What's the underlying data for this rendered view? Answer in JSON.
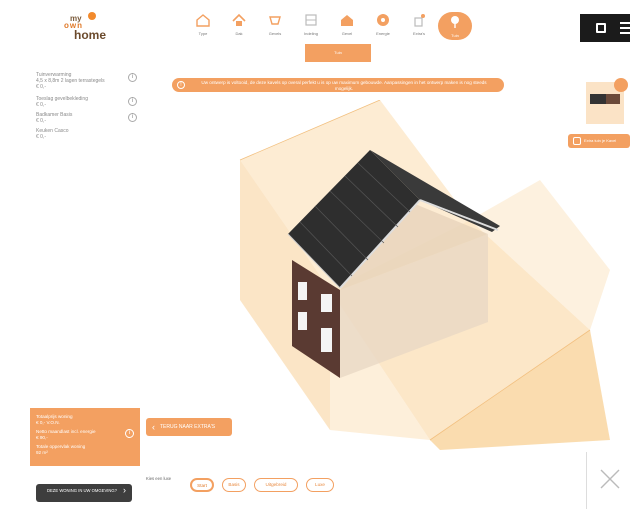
{
  "logo": {
    "line1": "my",
    "line2": "own",
    "line3": "home"
  },
  "nav": {
    "items": [
      {
        "label": "Type",
        "icon": "house-outline-icon"
      },
      {
        "label": "Dak",
        "icon": "roof-icon"
      },
      {
        "label": "Gevels",
        "icon": "facade-icon"
      },
      {
        "label": "Indeling",
        "icon": "floorplan-icon"
      },
      {
        "label": "Gevel",
        "icon": "house-filled-icon"
      },
      {
        "label": "Energie",
        "icon": "energy-icon"
      },
      {
        "label": "Extra's",
        "icon": "extras-icon"
      },
      {
        "label": "Tuin",
        "icon": "tree-icon"
      }
    ],
    "active_subtab": "Tuin"
  },
  "options": [
    {
      "title": "Tuinverwarming",
      "detail": "4,5 x 8,8m 2 lagen terrastegels",
      "price": "€ 0,-"
    },
    {
      "title": "Toeslag gevelbekleding",
      "detail": "",
      "price": "€ 0,-"
    },
    {
      "title": "Badkamer Basis",
      "detail": "",
      "price": "€ 0,-"
    },
    {
      "title": "Keuken Casco",
      "detail": "",
      "price": "€ 0,-"
    }
  ],
  "notice": {
    "text": "Uw ontwerp is voltooid, de deze kavels op overal perfekt u is op uw maximum gebouwde. Aanpassingen in het ontwerp maken is nog steeds mogelijk."
  },
  "add_button": {
    "label": "Extra tuin je Kavel"
  },
  "summary": {
    "rows": [
      {
        "label": "Totaalprijs woning",
        "value": "€ 0,- V.O.N."
      },
      {
        "label": "Netto maandlast incl. energie",
        "value": "€ 90,-"
      },
      {
        "label": "Totale oppervlak woning",
        "value": "92 m²"
      }
    ]
  },
  "back_button": {
    "label": "TERUG NAAR EXTRA'S"
  },
  "generate_button": {
    "label": "DEZE WONING IN UW OMGEVING?"
  },
  "level": {
    "label": "Kies een luxe",
    "options": [
      "Start",
      "Basis",
      "Uitgebreid",
      "Luxe"
    ],
    "selected": "Start"
  },
  "colors": {
    "accent": "#f3a061",
    "dark": "#1b1b1b",
    "brick": "#5a3a32",
    "roof": "#2e2e2e"
  }
}
